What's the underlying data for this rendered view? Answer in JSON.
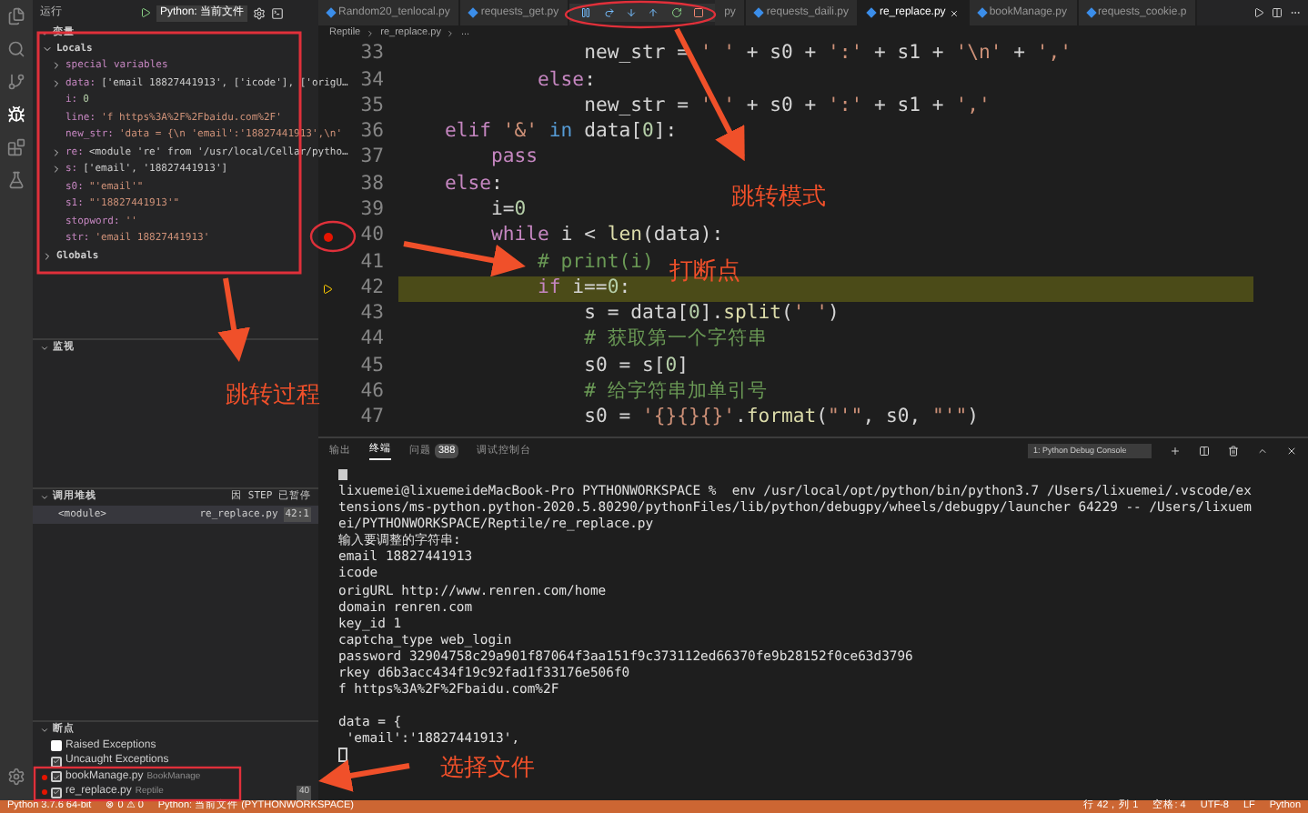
{
  "sidebar": {
    "title": "运行",
    "config": "Python: 当前文件",
    "variables": {
      "heading": "变量",
      "scopes": [
        {
          "label": "Locals",
          "expanded": true,
          "children": [
            {
              "name": "special variables",
              "expanded": false
            },
            {
              "name": "data:",
              "value": "['email 18827441913', ['icode'], ['origU…",
              "kind": "other",
              "expanded": false
            },
            {
              "name": "i:",
              "value": "0",
              "kind": "number"
            },
            {
              "name": "line:",
              "value": "'f https%3A%2F%2Fbaidu.com%2F'",
              "kind": "string"
            },
            {
              "name": "new_str:",
              "value": "'data = {\\n 'email':'18827441913',\\n'",
              "kind": "string"
            },
            {
              "name": "re:",
              "value": "<module 're' from '/usr/local/Cellar/pytho…",
              "kind": "other",
              "expanded": false
            },
            {
              "name": "s:",
              "value": "['email', '18827441913']",
              "kind": "other",
              "expanded": false
            },
            {
              "name": "s0:",
              "value": "\"'email'\"",
              "kind": "string"
            },
            {
              "name": "s1:",
              "value": "\"'18827441913'\"",
              "kind": "string"
            },
            {
              "name": "stopword:",
              "value": "''",
              "kind": "string"
            },
            {
              "name": "str:",
              "value": "'email 18827441913'",
              "kind": "string"
            }
          ]
        },
        {
          "label": "Globals",
          "expanded": false
        }
      ]
    },
    "watch": {
      "heading": "监视"
    },
    "call_stack": {
      "heading": "调用堆栈",
      "status": "因 STEP 已暂停",
      "frames": [
        {
          "name": "<module>",
          "file": "re_replace.py",
          "position": "42:1"
        }
      ]
    },
    "breakpoints": {
      "heading": "断点",
      "items": [
        {
          "kind": "exception",
          "label": "Raised Exceptions",
          "checked": false
        },
        {
          "kind": "exception",
          "label": "Uncaught Exceptions",
          "checked": true
        },
        {
          "kind": "file",
          "label": "bookManage.py",
          "detail": "BookManage",
          "checked": true
        },
        {
          "kind": "file",
          "label": "re_replace.py",
          "detail": "Reptile",
          "count": "40",
          "checked": true
        }
      ]
    }
  },
  "tabs": [
    {
      "label": "Random20_tenlocal.py",
      "selected": false
    },
    {
      "label": "requests_get.py",
      "selected": false
    },
    {
      "label": "py",
      "selected": false
    },
    {
      "label": "requests_daili.py",
      "selected": false
    },
    {
      "label": "re_replace.py",
      "selected": true
    },
    {
      "label": "bookManage.py",
      "selected": false
    },
    {
      "label": "requests_cookie.p",
      "selected": false
    }
  ],
  "breadcrumb": [
    "Reptile",
    "re_replace.py",
    "..."
  ],
  "code": [
    {
      "number": "33",
      "tokens": [
        {
          "kind": "plain",
          "text": "                new_str = "
        },
        {
          "kind": "str",
          "text": "' '"
        },
        {
          "kind": "plain",
          "text": " + s0 + "
        },
        {
          "kind": "str",
          "text": "':'"
        },
        {
          "kind": "plain",
          "text": " + s1 + "
        },
        {
          "kind": "str",
          "text": "'\\n'"
        },
        {
          "kind": "plain",
          "text": " + "
        },
        {
          "kind": "str",
          "text": "','"
        }
      ]
    },
    {
      "number": "34",
      "tokens": [
        {
          "kind": "kw",
          "text": "            else"
        },
        {
          "kind": "plain",
          "text": ":"
        }
      ]
    },
    {
      "number": "35",
      "tokens": [
        {
          "kind": "plain",
          "text": "                new_str = "
        },
        {
          "kind": "str",
          "text": "' '"
        },
        {
          "kind": "plain",
          "text": " + s0 + "
        },
        {
          "kind": "str",
          "text": "':'"
        },
        {
          "kind": "plain",
          "text": " + s1 + "
        },
        {
          "kind": "str",
          "text": "','"
        }
      ]
    },
    {
      "number": "36",
      "tokens": [
        {
          "kind": "kw",
          "text": "    elif "
        },
        {
          "kind": "str",
          "text": "'&'"
        },
        {
          "kind": "op",
          "text": " in "
        },
        {
          "kind": "plain",
          "text": "data["
        },
        {
          "kind": "num",
          "text": "0"
        },
        {
          "kind": "plain",
          "text": "]:"
        }
      ]
    },
    {
      "number": "37",
      "tokens": [
        {
          "kind": "kw",
          "text": "        pass"
        }
      ]
    },
    {
      "number": "38",
      "tokens": [
        {
          "kind": "kw",
          "text": "    else"
        },
        {
          "kind": "plain",
          "text": ":"
        }
      ]
    },
    {
      "number": "39",
      "tokens": [
        {
          "kind": "plain",
          "text": "        i="
        },
        {
          "kind": "num",
          "text": "0"
        }
      ]
    },
    {
      "number": "40",
      "breakpoint": true,
      "tokens": [
        {
          "kind": "kw",
          "text": "        while "
        },
        {
          "kind": "plain",
          "text": "i < "
        },
        {
          "kind": "fn",
          "text": "len"
        },
        {
          "kind": "plain",
          "text": "(data):"
        }
      ]
    },
    {
      "number": "41",
      "tokens": [
        {
          "kind": "cmt",
          "text": "            # print(i)"
        }
      ]
    },
    {
      "number": "42",
      "current": true,
      "tokens": [
        {
          "kind": "kw",
          "text": "            if "
        },
        {
          "kind": "plain",
          "text": "i=="
        },
        {
          "kind": "num",
          "text": "0"
        },
        {
          "kind": "plain",
          "text": ":"
        }
      ]
    },
    {
      "number": "43",
      "tokens": [
        {
          "kind": "plain",
          "text": "                s = data["
        },
        {
          "kind": "num",
          "text": "0"
        },
        {
          "kind": "plain",
          "text": "]."
        },
        {
          "kind": "fn",
          "text": "split"
        },
        {
          "kind": "plain",
          "text": "("
        },
        {
          "kind": "str",
          "text": "' '"
        },
        {
          "kind": "plain",
          "text": ")"
        }
      ]
    },
    {
      "number": "44",
      "tokens": [
        {
          "kind": "cmt",
          "text": "                # 获取第一个字符串"
        }
      ]
    },
    {
      "number": "45",
      "tokens": [
        {
          "kind": "plain",
          "text": "                s0 = s["
        },
        {
          "kind": "num",
          "text": "0"
        },
        {
          "kind": "plain",
          "text": "]"
        }
      ]
    },
    {
      "number": "46",
      "tokens": [
        {
          "kind": "cmt",
          "text": "                # 给字符串加单引号"
        }
      ]
    },
    {
      "number": "47",
      "tokens": [
        {
          "kind": "plain",
          "text": "                s0 = "
        },
        {
          "kind": "str",
          "text": "'{}{}{}'"
        },
        {
          "kind": "plain",
          "text": "."
        },
        {
          "kind": "fn",
          "text": "format"
        },
        {
          "kind": "plain",
          "text": "("
        },
        {
          "kind": "str",
          "text": "\"'\""
        },
        {
          "kind": "plain",
          "text": ", s0, "
        },
        {
          "kind": "str",
          "text": "\"'\""
        },
        {
          "kind": "plain",
          "text": ")"
        }
      ]
    }
  ],
  "panel": {
    "tabs": [
      {
        "label": "输出",
        "selected": false
      },
      {
        "label": "终端",
        "selected": true
      },
      {
        "label": "问题",
        "badge": "388",
        "selected": false
      },
      {
        "label": "调试控制台",
        "selected": false
      }
    ],
    "terminal_select": "1: Python Debug Console",
    "terminal": [
      [
        "lixuemei@lixuemeideMacBook-Pro PYTHONWORKSPACE %  env /usr/local/opt/python/bin/python3.7 /Users/lixuemei/.vscode/ex",
        "tensions/ms-python.python-2020.5.80290/pythonFiles/lib/python/debugpy/wheels/debugpy/launcher 64229 -- /Users/lixuem",
        "ei/PYTHONWORKSPACE/Reptile/re_replace.py",
        "输入要调整的字符串:",
        "email 18827441913",
        "icode",
        "origURL http://www.renren.com/home",
        "domain renren.com",
        "key_id 1",
        "captcha_type web_login",
        "password 32904758c29a901f87064f3aa151f9c373112ed66370fe9b28152f0ce63d3796",
        "rkey d6b3acc434f19c92fad1f33176e506f0",
        "f https%3A%2F%2Fbaidu.com%2F"
      ],
      [
        "data = {",
        " 'email':'18827441913',"
      ]
    ]
  },
  "status_bar": {
    "left": [
      "Python 3.7.6 64-bit",
      "⊗ 0  ⚠ 0",
      "Python: 当前文件 (PYTHONWORKSPACE)"
    ],
    "right": [
      "行 42，列 1",
      "空格: 4",
      "UTF-8",
      "LF",
      "Python"
    ]
  },
  "annotations": [
    {
      "text": "跳转模式"
    },
    {
      "text": "打断点"
    },
    {
      "text": "跳转过程"
    },
    {
      "text": "选择文件"
    }
  ]
}
